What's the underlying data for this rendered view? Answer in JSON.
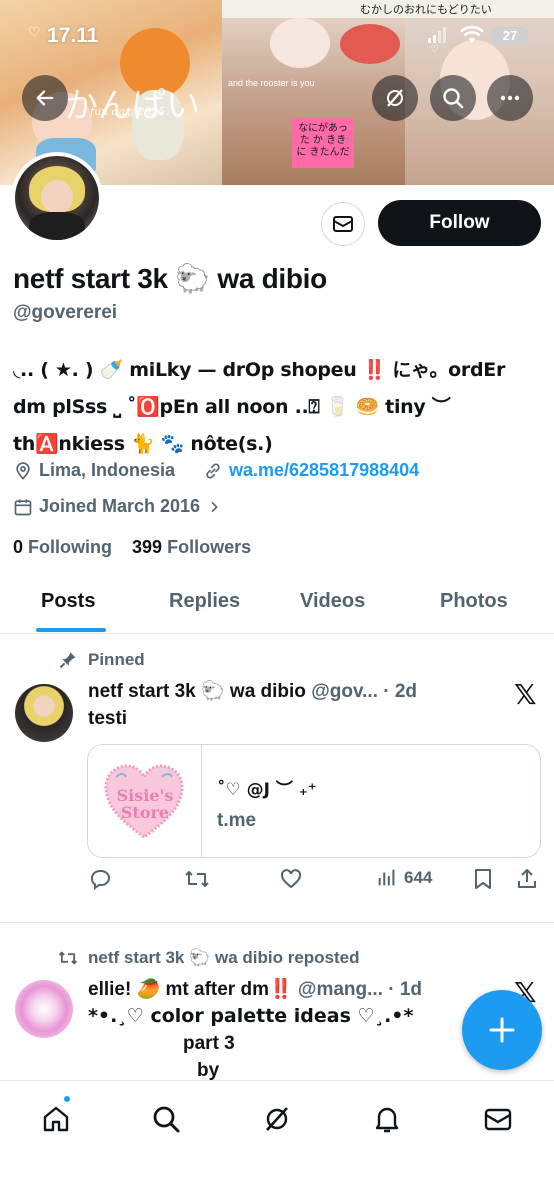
{
  "status_bar": {
    "time": "17.11",
    "battery": "27"
  },
  "banner": {
    "top_text": "むかしのおれにもどりたい",
    "deco_text_1": "かんぱい",
    "deco_text_2": "fun day, 2025.",
    "deco_text_3": "and the rooster is you",
    "pink_note": "なにがあった か ききに きたんだ"
  },
  "profile": {
    "display_name": "netf start 3k 🐑 wa dibio",
    "handle": "@govererei",
    "bio_line1": "◟.. ( ★. ) 🍼 miLky — drOp shopeu ‼️ にゃ。ordEr",
    "bio_line2": "dm plSss ⎵ ˚🅾️pEn all noon ..⍰ 🥛 🥯 tiny ︶",
    "bio_line3": "th🅰️nkiess 🐈 🐾 nôte(s.)",
    "location": "Lima, Indonesia",
    "link": "wa.me/6285817988404",
    "joined": "Joined March 2016",
    "following_count": "0",
    "following_label": "Following",
    "followers_count": "399",
    "followers_label": "Followers"
  },
  "buttons": {
    "follow": "Follow"
  },
  "tabs": [
    {
      "label": "Posts",
      "active": true
    },
    {
      "label": "Replies",
      "active": false
    },
    {
      "label": "Videos",
      "active": false
    },
    {
      "label": "Photos",
      "active": false
    }
  ],
  "posts": [
    {
      "context": "Pinned",
      "name": "netf start 3k 🐑 wa dibio",
      "meta": "@gov... · 2d",
      "text": "testi",
      "card": {
        "image_text": "Sisie's Store",
        "title": "˚♡ @J ︶ ₊⁺",
        "domain": "t.me"
      },
      "views": "644"
    },
    {
      "context": "netf start 3k 🐑 wa dibio reposted",
      "name": "ellie! 🥭 mt after dm‼️",
      "meta": "@mang... · 1d",
      "line1": "*•.¸♡ color palette ideas ♡¸.•*",
      "line2": "part 3",
      "line3": "by"
    }
  ],
  "colors": {
    "accent": "#1d9bf0",
    "text": "#0f1419",
    "muted": "#536471",
    "follow_bg": "#0f1419"
  }
}
